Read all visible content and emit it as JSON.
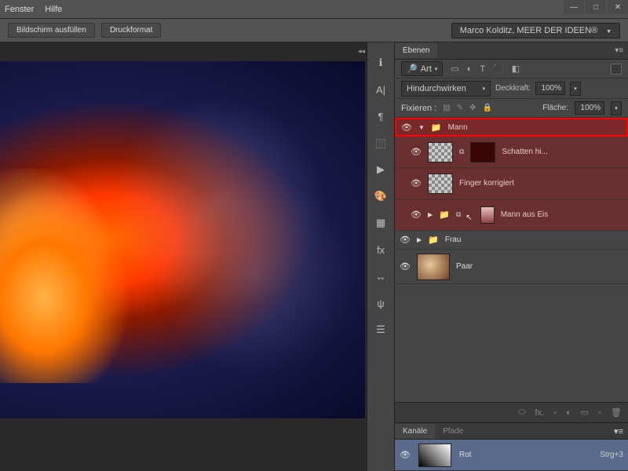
{
  "menu": {
    "fenster": "Fenster",
    "hilfe": "Hilfe"
  },
  "window_controls": {
    "min": "—",
    "max": "□",
    "close": "✕"
  },
  "toolbar": {
    "fullscreen": "Bildschirm ausfüllen",
    "print_format": "Druckformat"
  },
  "creator_label": "Marco Kolditz, MEER DER IDEEN®",
  "mini_tools": [
    "ℹ",
    "A|",
    "¶",
    "⿲",
    "▶",
    "🎨",
    "▦",
    "fx",
    "↔",
    "ψ",
    "☰"
  ],
  "layers_panel": {
    "title": "Ebenen",
    "kind": "Art",
    "filter_icons": [
      "▭",
      "◐",
      "T",
      "⬛",
      "◧"
    ],
    "blend_mode": "Hindurchwirken",
    "opacity_label": "Deckkraft:",
    "opacity_value": "100%",
    "lock_label": "Fixieren :",
    "fill_label": "Fläche:",
    "fill_value": "100%"
  },
  "layers": {
    "group_mann": "Mann",
    "schatten": "Schatten hi...",
    "finger": "Finger korrigiert",
    "mann_eis": "Mann aus Eis",
    "frau": "Frau",
    "paar": "Paar"
  },
  "footer_icons": [
    "⬭",
    "fx.",
    "▫",
    "◐",
    "▭",
    "🗑"
  ],
  "channels": {
    "tab_channels": "Kanäle",
    "tab_paths": "Pfade",
    "rot_name": "Rot",
    "rot_shortcut": "Strg+3"
  }
}
